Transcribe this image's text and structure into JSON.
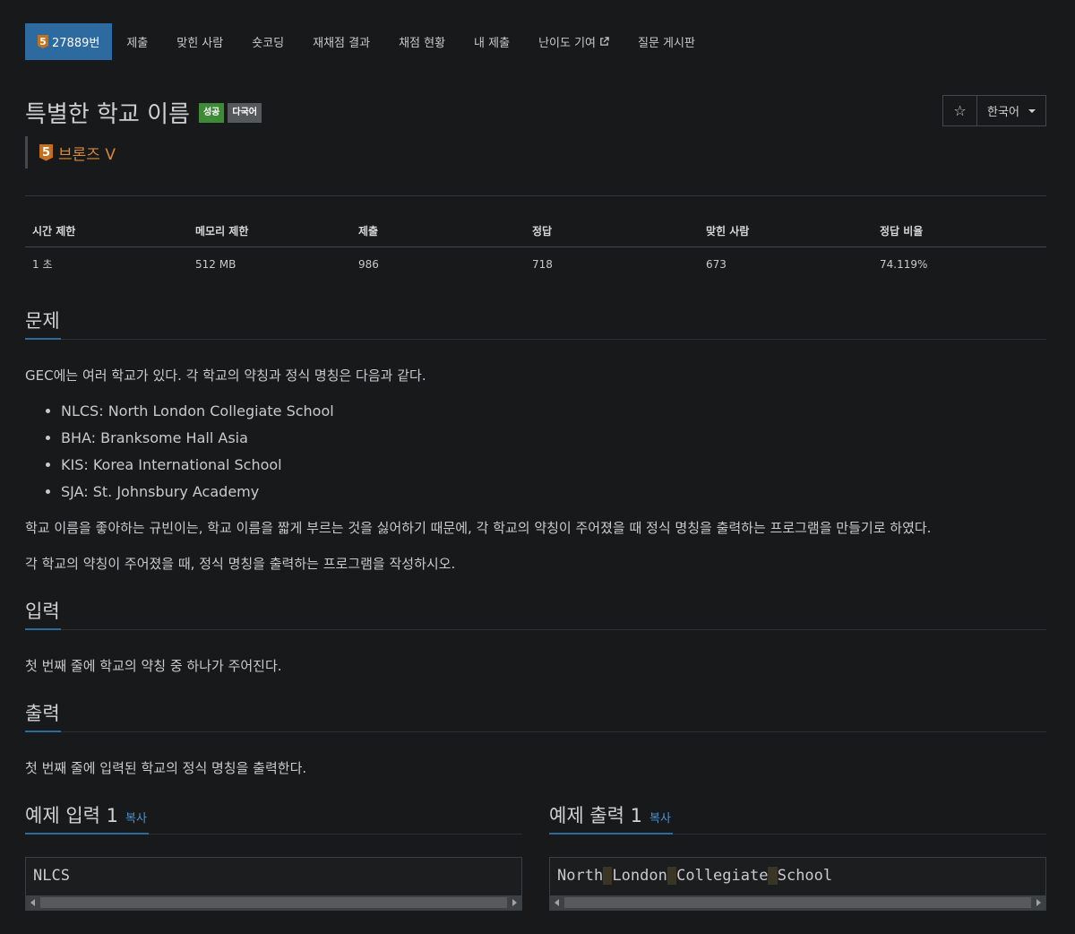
{
  "nav": {
    "problem_number": "27889번",
    "tier_digit": "5",
    "items": [
      "제출",
      "맞힌 사람",
      "숏코딩",
      "재채점 결과",
      "채점 현황",
      "내 제출",
      "난이도 기여",
      "질문 게시판"
    ]
  },
  "header": {
    "title": "특별한 학교 이름",
    "label_success": "성공",
    "label_multi": "다국어",
    "tier_digit": "5",
    "tier_text": "브론즈 V",
    "star": "☆",
    "language": "한국어"
  },
  "info": {
    "headers": [
      "시간 제한",
      "메모리 제한",
      "제출",
      "정답",
      "맞힌 사람",
      "정답 비율"
    ],
    "values": [
      "1 초",
      "512 MB",
      "986",
      "718",
      "673",
      "74.119%"
    ]
  },
  "problem": {
    "title": "문제",
    "intro": "GEC에는 여러 학교가 있다. 각 학교의 약칭과 정식 명칭은 다음과 같다.",
    "schools": [
      "NLCS: North London Collegiate School",
      "BHA: Branksome Hall Asia",
      "KIS: Korea International School",
      "SJA: St. Johnsbury Academy"
    ],
    "p2": "학교 이름을 좋아하는 규빈이는, 학교 이름을 짧게 부르는 것을 싫어하기 때문에, 각 학교의 약칭이 주어졌을 때 정식 명칭을 출력하는 프로그램을 만들기로 하였다.",
    "p3": "각 학교의 약칭이 주어졌을 때, 정식 명칭을 출력하는 프로그램을 작성하시오."
  },
  "input": {
    "title": "입력",
    "text": "첫 번째 줄에 학교의 약칭 중 하나가 주어진다."
  },
  "output": {
    "title": "출력",
    "text": "첫 번째 줄에 입력된 학교의 정식 명칭을 출력한다."
  },
  "samples": {
    "input_title": "예제 입력 1",
    "output_title": "예제 출력 1",
    "copy_label": "복사",
    "input_value": "NLCS",
    "output_words": [
      "North",
      "London",
      "Collegiate",
      "School"
    ]
  }
}
